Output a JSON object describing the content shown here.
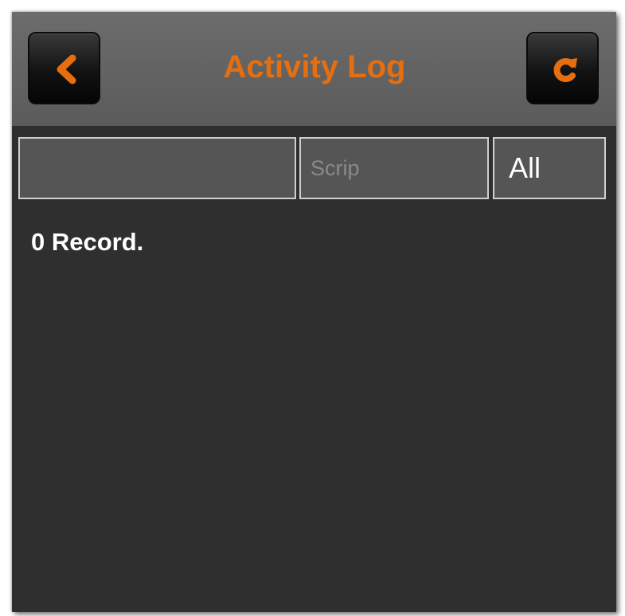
{
  "header": {
    "title": "Activity Log",
    "back_icon": "chevron-left-icon",
    "refresh_icon": "refresh-icon",
    "accent_color": "#e56f10"
  },
  "filters": {
    "name_value": "",
    "scrip_value": "",
    "scrip_placeholder": "Scrip",
    "type_selected": "All"
  },
  "records": {
    "count_text": "0 Record."
  }
}
